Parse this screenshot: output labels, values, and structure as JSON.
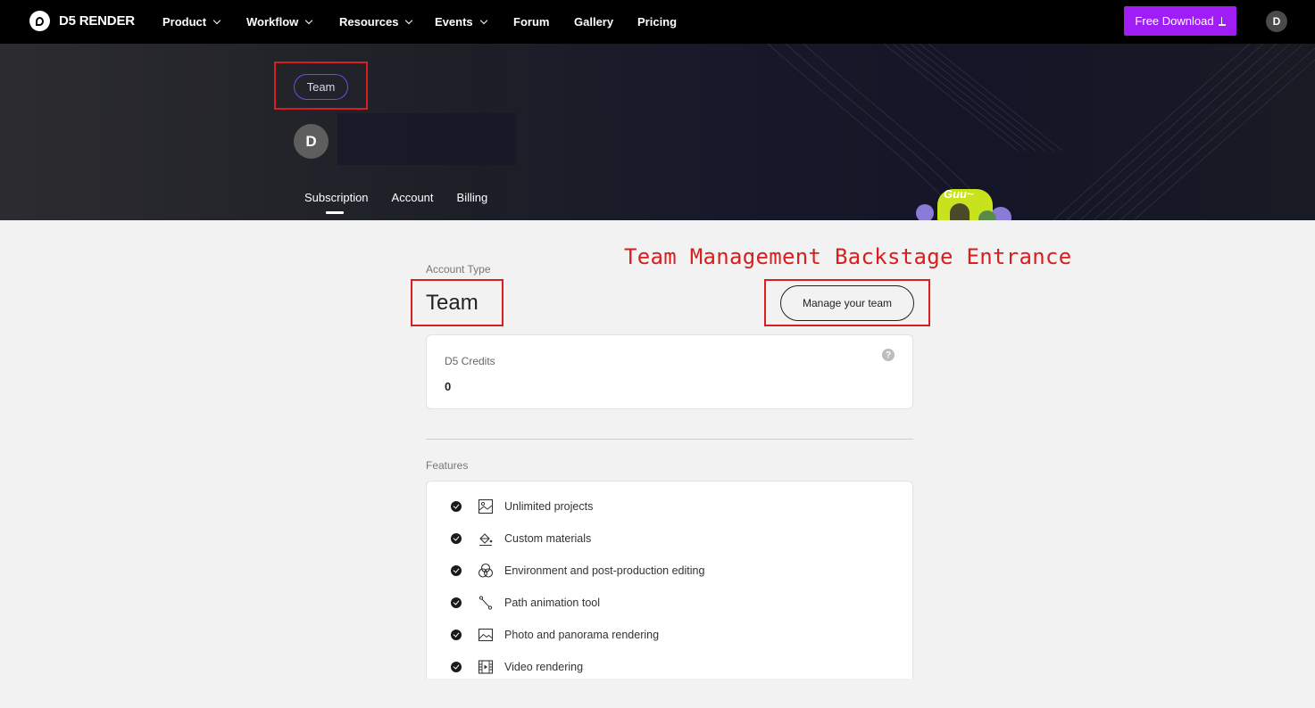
{
  "nav": {
    "brand": "D5 RENDER",
    "items": [
      {
        "label": "Product",
        "dropdown": true
      },
      {
        "label": "Workflow",
        "dropdown": true
      },
      {
        "label": "Resources",
        "dropdown": true
      },
      {
        "label": "Events",
        "dropdown": true
      },
      {
        "label": "Forum",
        "dropdown": false
      },
      {
        "label": "Gallery",
        "dropdown": false
      },
      {
        "label": "Pricing",
        "dropdown": false
      }
    ],
    "download_label": "Free Download",
    "avatar_initial": "D"
  },
  "hero": {
    "badge": "Team",
    "avatar_initial": "D",
    "tabs": [
      "Subscription",
      "Account",
      "Billing"
    ],
    "active_tab": "Subscription",
    "mascot_text": "Guu~"
  },
  "annotation": {
    "label": "Team Management Backstage Entrance",
    "color": "#d81e1e"
  },
  "account": {
    "type_label": "Account Type",
    "type_value": "Team",
    "manage_button": "Manage your team"
  },
  "credits": {
    "label": "D5 Credits",
    "value": "0",
    "help_glyph": "?"
  },
  "features": {
    "label": "Features",
    "items": [
      {
        "icon": "image-frame-icon",
        "text": "Unlimited projects"
      },
      {
        "icon": "paint-bucket-icon",
        "text": "Custom materials"
      },
      {
        "icon": "color-circles-icon",
        "text": "Environment and post-production editing"
      },
      {
        "icon": "path-node-icon",
        "text": "Path animation tool"
      },
      {
        "icon": "landscape-image-icon",
        "text": "Photo and panorama rendering"
      },
      {
        "icon": "film-strip-icon",
        "text": "Video rendering"
      }
    ]
  },
  "colors": {
    "accent": "#a01ef5",
    "badge_border": "#5a55e8",
    "annotation": "#d81e1e"
  }
}
